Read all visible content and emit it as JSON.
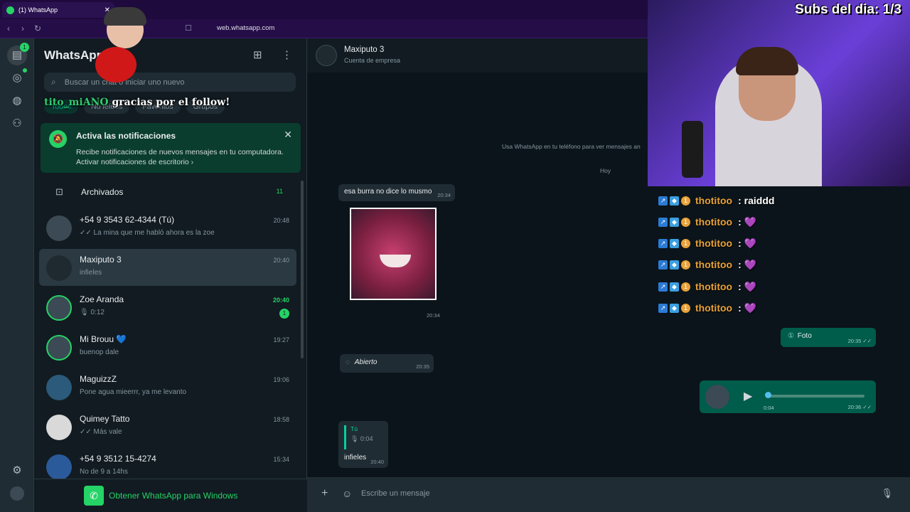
{
  "browser": {
    "tab_title": "(1) WhatsApp",
    "url": "web.whatsapp.com"
  },
  "rail": {
    "chats_badge": "1"
  },
  "sidebar": {
    "brand": "WhatsApp",
    "search_placeholder": "Buscar un chat o iniciar uno nuevo",
    "filters": [
      "Todos",
      "No leídos",
      "Favoritos",
      "Grupos"
    ],
    "notification": {
      "title": "Activa las notificaciones",
      "desc": "Recibe notificaciones de nuevos mensajes en tu computadora.",
      "link": "Activar notificaciones de escritorio"
    },
    "archived": {
      "label": "Archivados",
      "count": "11"
    },
    "chats": [
      {
        "name": "+54 9 3543 62-4344 (Tú)",
        "time": "20:48",
        "preview": "✓✓ La mina que me habló ahora es la zoe"
      },
      {
        "name": "Maxiputo 3",
        "time": "20:40",
        "preview": "infieles"
      },
      {
        "name": "Zoe Aranda",
        "time": "20:40",
        "preview": "🎙 0:12",
        "unread": "1"
      },
      {
        "name": "Mi Brouu 💙",
        "time": "19:27",
        "preview": "buenop dale"
      },
      {
        "name": "MaguizzZ",
        "time": "19:06",
        "preview": "Pone agua mieerrr, ya me levanto"
      },
      {
        "name": "Quimey Tatto",
        "time": "18:58",
        "preview": "✓✓ Más vale"
      },
      {
        "name": "+54 9 3512 15-4274",
        "time": "15:34",
        "preview": "No de 9 a 14hs"
      }
    ],
    "get_windows": "Obtener WhatsApp para Windows"
  },
  "chat": {
    "name": "Maxiputo 3",
    "subtitle": "Cuenta de empresa",
    "system_msg": "Usa WhatsApp en tu teléfono para ver mensajes an",
    "date": "Hoy",
    "messages": {
      "m1_text": "esa burra no dice lo musmo",
      "m1_time": "20:34",
      "photo_time": "20:34",
      "opened_text": "Abierto",
      "opened_time": "20:35",
      "foto_text": "Foto",
      "foto_time": "20:35 ✓✓",
      "audio_len": "0:04",
      "audio_time": "20:36 ✓✓",
      "reply_author": "Tú",
      "reply_audio": "🎙 0:04",
      "reply_text": "infieles",
      "reply_time": "20:40"
    },
    "input_placeholder": "Escribe un mensaje"
  },
  "stream": {
    "subs": "Subs del dia: 1/3",
    "follow_user": "tito_miANO",
    "follow_msg": "gracias por el follow!",
    "chat": [
      {
        "user": "thotitoo",
        "msg": ": raiddd"
      },
      {
        "user": "thotitoo",
        "msg": ": 💜"
      },
      {
        "user": "thotitoo",
        "msg": ": 💜"
      },
      {
        "user": "thotitoo",
        "msg": ": 💜"
      },
      {
        "user": "thotitoo",
        "msg": ": 💜"
      },
      {
        "user": "thotitoo",
        "msg": ": 💜"
      }
    ]
  },
  "colors": {
    "accent": "#25d366",
    "panel": "#111b21",
    "bg": "#0b141a",
    "out_bubble": "#005c4b"
  }
}
